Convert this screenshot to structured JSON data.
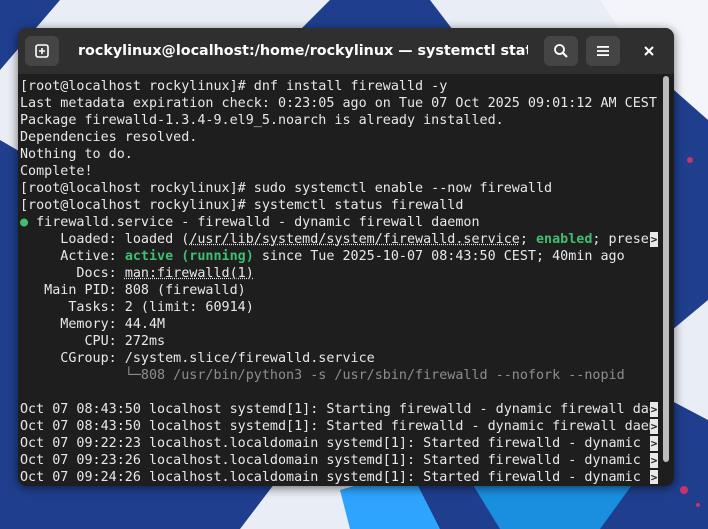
{
  "window": {
    "title": "rockylinux@localhost:/home/rockylinux — systemctl status fire…"
  },
  "titlebar": {
    "new_tab_icon": "new-tab-icon",
    "search_icon": "search-icon",
    "menu_icon": "hamburger-menu-icon",
    "close_icon": "close-icon"
  },
  "terminal": {
    "lines": [
      "[root@localhost rockylinux]# dnf install firewalld -y",
      "Last metadata expiration check: 0:23:05 ago on Tue 07 Oct 2025 09:01:12 AM CEST.",
      "Package firewalld-1.3.4-9.el9_5.noarch is already installed.",
      "Dependencies resolved.",
      "Nothing to do.",
      "Complete!",
      "[root@localhost rockylinux]# sudo systemctl enable --now firewalld",
      "[root@localhost rockylinux]# systemctl status firewalld"
    ],
    "service_dot": "●",
    "service_line": " firewalld.service - firewalld - dynamic firewall daemon",
    "loaded_prefix": "     Loaded: loaded (",
    "loaded_path": "/usr/lib/systemd/system/firewalld.service",
    "loaded_sep": "; ",
    "loaded_enabled": "enabled",
    "loaded_suffix": "; preset",
    "active_prefix": "     Active: ",
    "active_state": "active (running)",
    "active_suffix": " since Tue 2025-10-07 08:43:50 CEST; 40min ago",
    "docs_prefix": "       Docs: ",
    "docs_value": "man:firewalld(1)",
    "status_lines": [
      "   Main PID: 808 (firewalld)",
      "      Tasks: 2 (limit: 60914)",
      "     Memory: 44.4M",
      "        CPU: 272ms",
      "     CGroup: /system.slice/firewalld.service"
    ],
    "cgroup_child": "             └─808 /usr/bin/python3 -s /usr/sbin/firewalld --nofork --nopid",
    "blank": " ",
    "log_lines": [
      "Oct 07 08:43:50 localhost systemd[1]: Starting firewalld - dynamic firewall dae",
      "Oct 07 08:43:50 localhost systemd[1]: Started firewalld - dynamic firewall daem",
      "Oct 07 09:22:23 localhost.localdomain systemd[1]: Started firewalld - dynamic f",
      "Oct 07 09:23:26 localhost.localdomain systemd[1]: Started firewalld - dynamic f",
      "Oct 07 09:24:26 localhost.localdomain systemd[1]: Started firewalld - dynamic f"
    ],
    "truncation_marker": ">"
  },
  "colors": {
    "terminal_bg": "#1e1e1e",
    "titlebar_bg": "#2f2f2f",
    "status_green": "#3fbf6f",
    "desktop_bg": "#1f3f8e"
  }
}
